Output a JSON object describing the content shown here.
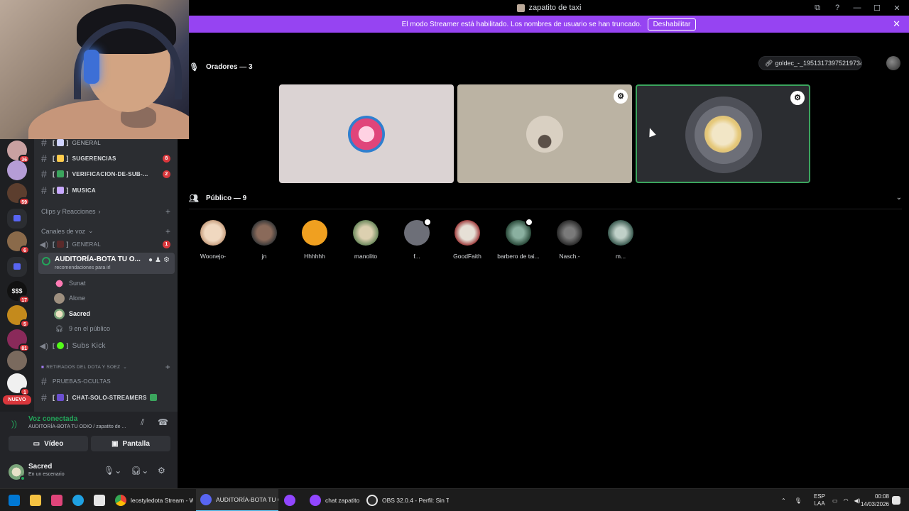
{
  "window": {
    "title": "zapatito de taxi",
    "controls": [
      "⧉",
      "?",
      "—",
      "☐",
      "✕"
    ]
  },
  "banner": {
    "text": "El modo Streamer está habilitado. Los nombres de usuario se han truncado.",
    "button": "Deshabilitar",
    "close": "✕"
  },
  "rail": {
    "badges": [
      "36",
      "42",
      "59",
      "6",
      "17",
      "5",
      "81",
      "1"
    ],
    "money_label": "$$$",
    "nuevo": "NUEVO"
  },
  "sidebar": {
    "channels_top": [
      {
        "name": "GENERAL",
        "prefix": "[",
        "suffix": "]",
        "count": ""
      },
      {
        "name": "SUGERENCIAS",
        "prefix": "[",
        "suffix": "]",
        "count": "8"
      },
      {
        "name": "VERIFICACION-DE-SUB-...",
        "prefix": "[",
        "suffix": "]",
        "count": "2"
      },
      {
        "name": "MUSICA",
        "prefix": "[",
        "suffix": "]",
        "count": ""
      }
    ],
    "cat_clips": "Clips y Reacciones",
    "cat_voice": "Canales de voz",
    "voice_general": {
      "name": "GENERAL",
      "count": "1"
    },
    "active_voice": {
      "name": "AUDITORÍA-BOTA TU O...",
      "status": "recomendaciones para irl"
    },
    "voice_users": [
      "Sunat",
      "Alone",
      "Sacred"
    ],
    "public_count": "9 en el público",
    "subs_kick": "Subs Kick",
    "cat_retirados": "RETIRADOS DEL DOTA Y SOEZ",
    "pruebas": "PRUEBAS-OCULTAS",
    "chat_streamers": "CHAT-SOLO-STREAMERS"
  },
  "voice_panel": {
    "title": "Voz conectada",
    "sub": "AUDITORÍA-BOTA TU ODIO / zapatito de ...",
    "video": "Vídeo",
    "screen": "Pantalla",
    "user_name": "Sacred",
    "user_status": "En un escenario"
  },
  "stage": {
    "speakers_label": "Oradores — 3",
    "invite_text": "goldec_-_19513173975219734...",
    "audience_label": "Público — 9",
    "audience": [
      "Woonejo-",
      "jn",
      "Hhhhhh",
      "manolito",
      "f...",
      "GoodFaith",
      "barbero de tai...",
      "Nasch.-",
      "m..."
    ]
  },
  "taskbar": {
    "apps": [
      {
        "label": "leostyledota Stream - W"
      },
      {
        "label": "AUDITORÍA-BOTA TU OI"
      },
      {
        "label": ""
      },
      {
        "label": "chat zapatito"
      },
      {
        "label": "OBS 32.0.4 - Perfil: Sin T"
      }
    ],
    "lang_top": "ESP",
    "lang_bottom": "LAA",
    "time": "00:08",
    "date": "14/03/2026"
  },
  "colors": {
    "banner": "#9644f2",
    "sidebar": "#2b2d31",
    "online": "#23a55a",
    "badge": "#da373c"
  }
}
